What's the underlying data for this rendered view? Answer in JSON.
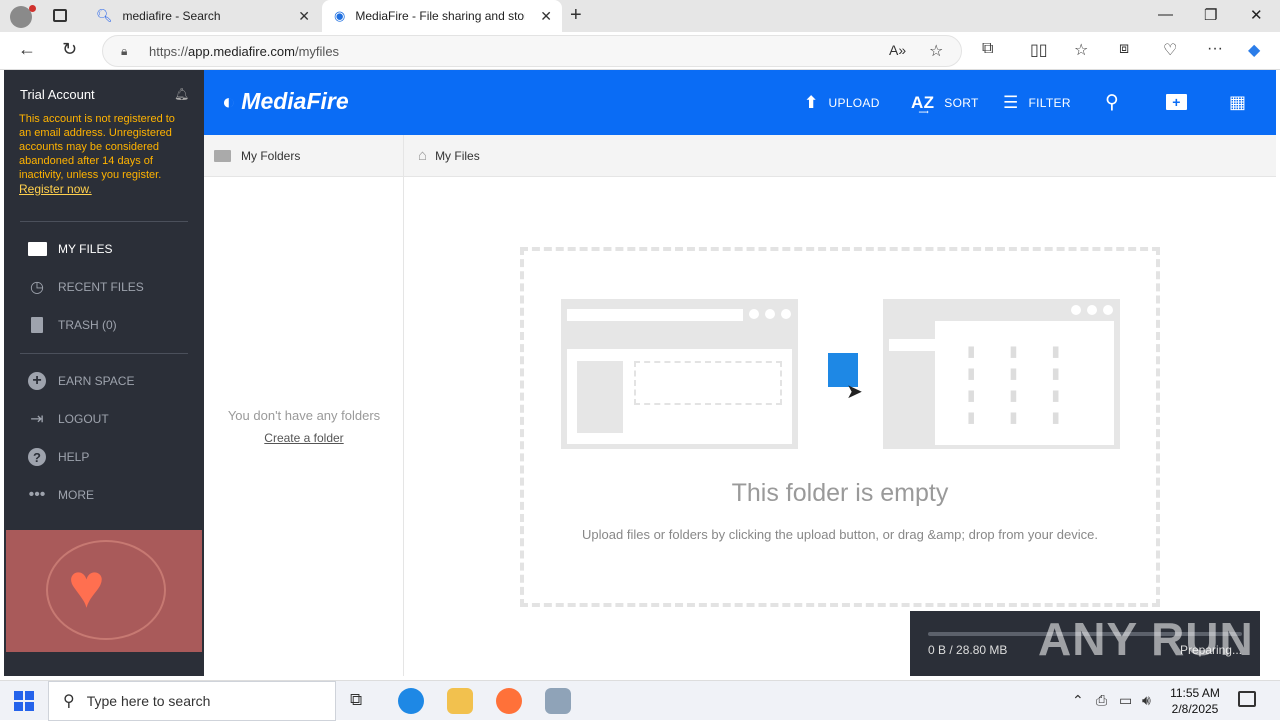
{
  "browser": {
    "tabs": [
      {
        "label": "mediafire - Search"
      },
      {
        "label": "MediaFire - File sharing and stora"
      }
    ],
    "url_prefix": "https://",
    "url_host": "app.mediafire.com",
    "url_path": "/myfiles"
  },
  "sidebar": {
    "account_title": "Trial Account",
    "warning": "This account is not registered to an email address. Unregistered accounts may be considered abandoned after 14 days of inactivity, unless you register.",
    "register_link": "Register now.",
    "items": [
      {
        "label": "MY FILES",
        "icon": "folder-icon"
      },
      {
        "label": "RECENT FILES",
        "icon": "clock-icon"
      },
      {
        "label": "TRASH (0)",
        "icon": "trash-icon"
      },
      {
        "label": "EARN SPACE",
        "icon": "plus-circle-icon"
      },
      {
        "label": "LOGOUT",
        "icon": "logout-icon"
      },
      {
        "label": "HELP",
        "icon": "help-icon"
      },
      {
        "label": "MORE",
        "icon": "more-icon"
      }
    ]
  },
  "header": {
    "logo_text": "MediaFire",
    "upload_label": "UPLOAD",
    "sort_label": "SORT",
    "filter_label": "FILTER"
  },
  "folders_pane": {
    "title": "My Folders",
    "empty_text": "You don't have any folders",
    "create_link": "Create a folder"
  },
  "files_pane": {
    "breadcrumb": "My Files",
    "empty_title": "This folder is empty",
    "empty_subtitle": "Upload files or folders by clicking the upload button, or drag &amp; drop from your device."
  },
  "upload_progress": {
    "size_text": "0 B / 28.80 MB",
    "status_text": "Preparing...",
    "progress": 0.0
  },
  "watermark": "ANY RUN",
  "taskbar": {
    "search_placeholder": "Type here to search",
    "time": "11:55 AM",
    "date": "2/8/2025"
  },
  "colors": {
    "header_blue": "#0a6cf5",
    "sidebar_bg": "#2b2f38",
    "warning_text": "#ffb300"
  }
}
